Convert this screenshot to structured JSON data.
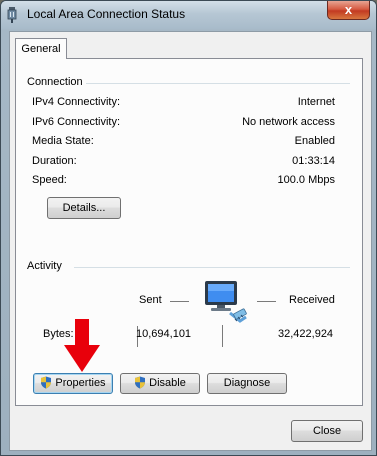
{
  "window": {
    "title": "Local Area Connection Status",
    "close_glyph": "x"
  },
  "tabs": [
    {
      "label": "General"
    }
  ],
  "connection": {
    "heading": "Connection",
    "rows": [
      {
        "label": "IPv4 Connectivity:",
        "value": "Internet"
      },
      {
        "label": "IPv6 Connectivity:",
        "value": "No network access"
      },
      {
        "label": "Media State:",
        "value": "Enabled"
      },
      {
        "label": "Duration:",
        "value": "01:33:14"
      },
      {
        "label": "Speed:",
        "value": "100.0 Mbps"
      }
    ],
    "details_label": "Details..."
  },
  "activity": {
    "heading": "Activity",
    "sent_label": "Sent",
    "received_label": "Received",
    "bytes_label": "Bytes:",
    "bytes_sent": "10,694,101",
    "bytes_received": "32,422,924"
  },
  "actions": {
    "properties_label": "Properties",
    "disable_label": "Disable",
    "diagnose_label": "Diagnose"
  },
  "footer": {
    "close_label": "Close"
  },
  "annotation": {
    "arrow_color": "#e8000b"
  },
  "icons": {
    "window_icon": "network-adapter-icon",
    "network_icon": "network-computer-icon",
    "uac_shield": "uac-shield-icon"
  }
}
